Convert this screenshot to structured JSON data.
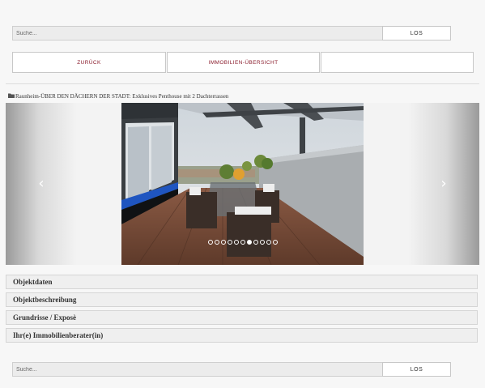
{
  "search_top": {
    "placeholder": "Suche...",
    "button": "LOS"
  },
  "nav": {
    "back": "ZURÜCK",
    "overview": "IMMOBILIEN-ÜBERSICHT",
    "third": ""
  },
  "breadcrumb": {
    "text": "Raunheim-ÜBER DEN DÄCHERN DER STADT: Exklusives Penthouse mit 2 Dachterrassen"
  },
  "gallery": {
    "total_slides": 11,
    "active_slide": 7
  },
  "accordion": [
    {
      "label": "Objektdaten"
    },
    {
      "label": "Objektbeschreibung"
    },
    {
      "label": "Grundrisse / Exposè"
    },
    {
      "label": "Ihr(e) Immobilienberater(in)"
    }
  ],
  "search_bottom": {
    "placeholder": "Suche...",
    "button": "LOS"
  }
}
